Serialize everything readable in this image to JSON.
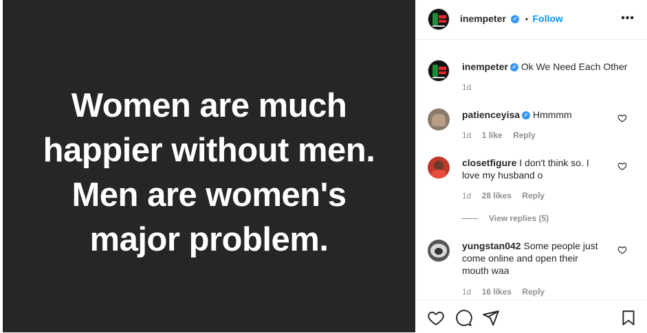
{
  "post": {
    "lines": [
      "Women are much",
      "happier without men.",
      "Men are women's",
      "major problem."
    ]
  },
  "header": {
    "username": "inempeter",
    "separator": "•",
    "follow_label": "Follow",
    "more_icon": "more-horizontal-icon",
    "more_label": "•••"
  },
  "caption": {
    "username": "inempeter",
    "text": "Ok We Need Each Other",
    "time": "1d"
  },
  "comments": [
    {
      "username": "patienceyisa",
      "verified": true,
      "text": "Hmmmm",
      "time": "1d",
      "likes": "1 like",
      "reply": "Reply"
    },
    {
      "username": "closetfigure",
      "verified": false,
      "text": "I don't think so. I love my husband o",
      "time": "1d",
      "likes": "28 likes",
      "reply": "Reply"
    },
    {
      "username": "yungstan042",
      "verified": false,
      "text": "Some people just come online and open their mouth waa",
      "time": "1d",
      "likes": "16 likes",
      "reply": "Reply"
    }
  ],
  "view_replies": "View replies (5)",
  "verified_mark": "✓",
  "actions": [
    "heart-icon",
    "comment-icon",
    "share-icon",
    "bookmark-icon"
  ],
  "colors": {
    "accent": "#0095f6",
    "verified": "#3897f0",
    "post_bg": "#262626",
    "muted": "#8e8e8e"
  }
}
